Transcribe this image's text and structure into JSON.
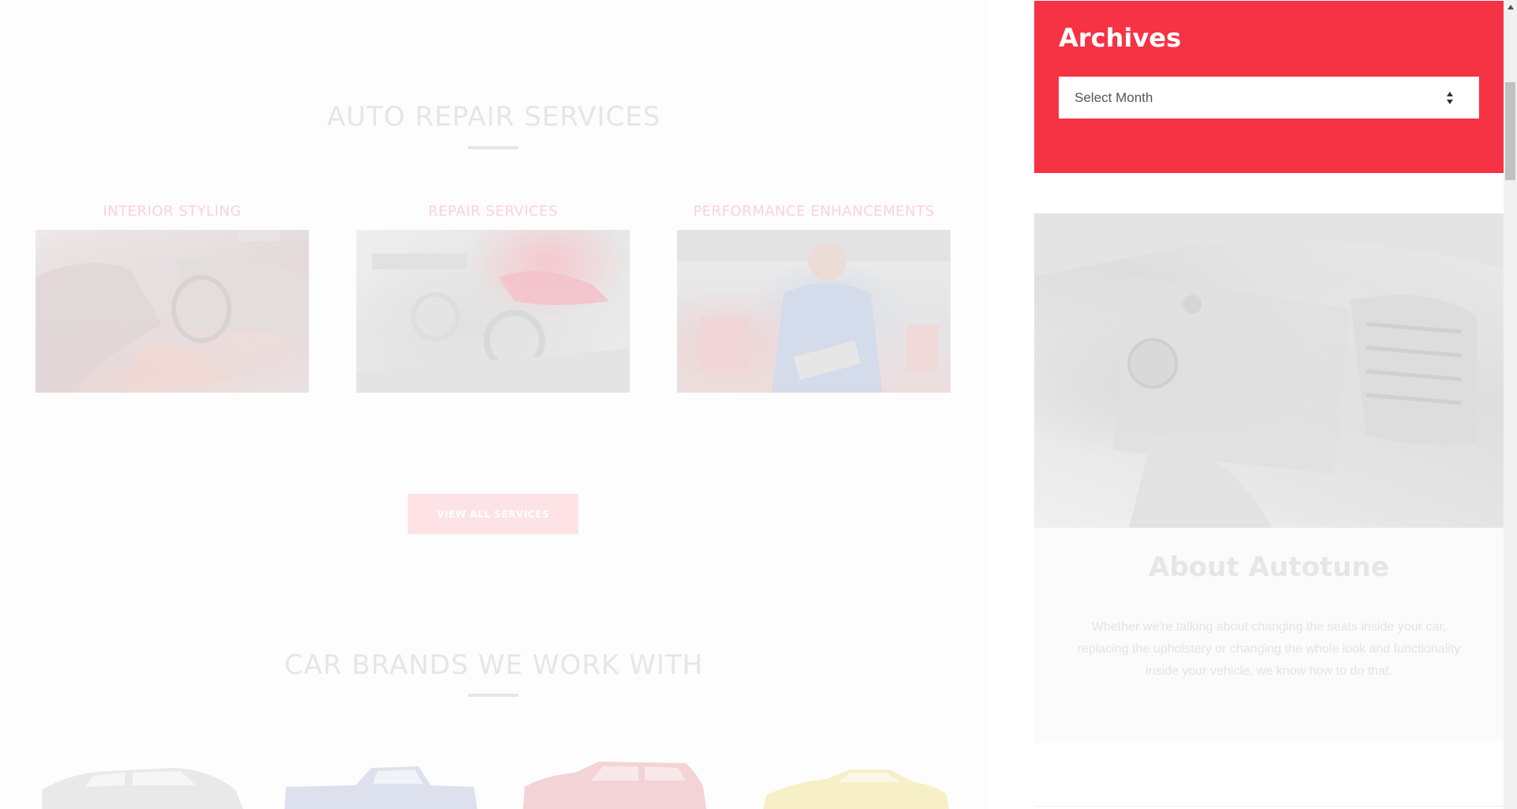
{
  "services_section": {
    "title": "AUTO REPAIR SERVICES",
    "services": [
      {
        "label": "INTERIOR STYLING"
      },
      {
        "label": "REPAIR SERVICES"
      },
      {
        "label": "PERFORMANCE ENHANCEMENTS"
      }
    ],
    "view_all_label": "VIEW ALL SERVICES"
  },
  "brands_section": {
    "title": "CAR BRANDS WE WORK WITH",
    "cars": [
      {
        "icon": "silver-suv-image",
        "color": "#e9e9ea"
      },
      {
        "icon": "blue-pickup-image",
        "color": "#dde1ee"
      },
      {
        "icon": "red-suv-image",
        "color": "#f3d3d6"
      },
      {
        "icon": "yellow-sports-car-image",
        "color": "#f7efc6"
      }
    ]
  },
  "sidebar": {
    "archives": {
      "title": "Archives",
      "select_value": "Select Month"
    },
    "about": {
      "title": "About Autotune",
      "text": "Whether we're talking about changing the seats inside your car, replacing the upholstery or changing the whole look and functionality inside your vehicle, we know how to do that."
    }
  },
  "colors": {
    "accent": "#f53344",
    "faded_title": "#e6e6e6",
    "faded_accent": "#fbd3d8"
  }
}
